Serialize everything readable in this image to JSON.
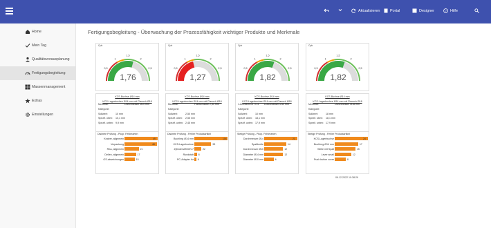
{
  "topbar": {
    "color": "#3e51ae",
    "refresh_label": "Aktualisieren",
    "portal_label": "Portal",
    "designer_label": "Designer",
    "hilfe_label": "Hilfe"
  },
  "sidebar": {
    "items": [
      {
        "label": "Home",
        "icon": "home-icon",
        "active": false
      },
      {
        "label": "Mein Tag",
        "icon": "check-icon",
        "active": false
      },
      {
        "label": "Qualitätsvorausplanung",
        "icon": "person-icon",
        "active": false
      },
      {
        "label": "Fertigungsbegleitung",
        "icon": "gauge-icon",
        "active": true
      },
      {
        "label": "Massenmanagement",
        "icon": "grid-icon",
        "active": false
      },
      {
        "label": "Extras",
        "icon": "star-icon",
        "active": false
      },
      {
        "label": "Einstellungen",
        "icon": "gear-icon",
        "active": false
      }
    ]
  },
  "page": {
    "title": "Fertigungsbegleitung  -  Überwachung der Prozessfähigkeit wichtiger Produkte und Merkmale",
    "timestamp": "09.12.2022 10:38:29"
  },
  "cards": [
    {
      "cpk_label": "Cpk",
      "cpk": 1.76,
      "cpk_text": "1,76",
      "ticks": [
        "0,5",
        "1",
        "1,5",
        "2",
        "2,5"
      ],
      "title1": "KCS-Buchse Ø14 mm",
      "title2": "KCS-Lagerbuchse Ø14 mm mit Flansch Ø18",
      "rows": [
        {
          "k": "Merkmal:",
          "v": "Durchmesser Ø10 mm"
        },
        {
          "k": "Kategorie:",
          "v": ""
        },
        {
          "k": "Sollwert:",
          "v": "10 mm"
        },
        {
          "k": "Spezif. oben:",
          "v": "10,1 mm"
        },
        {
          "k": "Spezif. unten:",
          "v": "9,9 mm"
        }
      ],
      "bar_title": "Diskrete Prüfung - Pkop. Fehlerarten",
      "bars": [
        {
          "label": "Kratzer, allgemein",
          "value": 49
        },
        {
          "label": "Verpackung",
          "value": 48
        },
        {
          "label": "Riss, allgemein",
          "value": 21
        },
        {
          "label": "Dellen, allgemein",
          "value": 17
        },
        {
          "label": "GS-abweichungen",
          "value": 15
        }
      ]
    },
    {
      "cpk_label": "Cpk",
      "cpk": 1.27,
      "cpk_text": "1,27",
      "ticks": [
        "0,5",
        "1",
        "1,5",
        "2",
        "2,5"
      ],
      "title1": "KCS-Buchse Ø14 mm",
      "title2": "KCS-Lagerbuchse Ø14 mm mit Flansch Ø18",
      "rows": [
        {
          "k": "Merkmal:",
          "v": "Flanschdicke 2,50 mm"
        },
        {
          "k": "Kategorie:",
          "v": ""
        },
        {
          "k": "Sollwert:",
          "v": "2,50 mm"
        },
        {
          "k": "Spezif. oben:",
          "v": "2,55 mm"
        },
        {
          "k": "Spezif. unten:",
          "v": "2,45 mm"
        }
      ],
      "bar_title": "Diskrete Prüfung - Fehler Produktartikel",
      "bars": [
        {
          "label": "Buchhng Ø14 mm",
          "value": 104
        },
        {
          "label": "KCS-Lagerbuchse",
          "value": 53
        },
        {
          "label": "Zylinderstift DIN 7",
          "value": 22
        },
        {
          "label": "Rundstab",
          "value": 8
        },
        {
          "label": "PC-Adapter fur",
          "value": 6
        }
      ]
    },
    {
      "cpk_label": "Cpk",
      "cpk": 1.82,
      "cpk_text": "1,82",
      "ticks": [
        "0,5",
        "1",
        "1,5",
        "2",
        "2,5"
      ],
      "title1": "KCS-Buchse Ø14 mm",
      "title2": "KCS-Lagerbuchse Ø14 mm mit Flansch Ø18",
      "rows": [
        {
          "k": "1-8219830-017714",
          "v": "Durchmesser Ø10 mm"
        },
        {
          "k": "Kategorie:",
          "v": ""
        },
        {
          "k": "Sollwert:",
          "v": "10 mm"
        },
        {
          "k": "Spezif. oben:",
          "v": "18,1 mm"
        },
        {
          "k": "Spezif. unten:",
          "v": "17,9 mm"
        }
      ],
      "bar_title": "Stetige Prüfung - Pkop. Fehlerarten",
      "bars": [
        {
          "label": "Durchmesser Ø14",
          "value": 21
        },
        {
          "label": "Spaltbreite",
          "value": 14
        },
        {
          "label": "Durchmesser Ø10",
          "value": 12
        },
        {
          "label": "Diameter Ø14 mm",
          "value": 12
        },
        {
          "label": "Diameter Ø10 mm",
          "value": 6
        }
      ]
    },
    {
      "cpk_label": "Cpk",
      "cpk": 1.82,
      "cpk_text": "1,82",
      "ticks": [
        "0,5",
        "1",
        "1,5",
        "2",
        "2,5"
      ],
      "title1": "KCS-Buchse Ø14 mm",
      "title2": "KCS-Lagerbuchse Ø14 mm mit Flansch Ø18",
      "rows": [
        {
          "k": "Merkmal:",
          "v": "Durchmesser Ø18 mm"
        },
        {
          "k": "Kategorie:",
          "v": ""
        },
        {
          "k": "Sollwert:",
          "v": "18 mm"
        },
        {
          "k": "Spezif. oben:",
          "v": "18,1 mm"
        },
        {
          "k": "Spezif. unten:",
          "v": "17,9 mm"
        }
      ],
      "bar_title": "Stetige Prüfung - Fehler Produktartikel",
      "bars": [
        {
          "label": "KCS-Lagerbuchse",
          "value": 24
        },
        {
          "label": "Buchhng Ø14 mm",
          "value": 17
        },
        {
          "label": "Welle mit Spalt",
          "value": 15
        },
        {
          "label": "Lever small",
          "value": 12
        },
        {
          "label": "Push button cover",
          "value": 8
        }
      ]
    }
  ]
}
